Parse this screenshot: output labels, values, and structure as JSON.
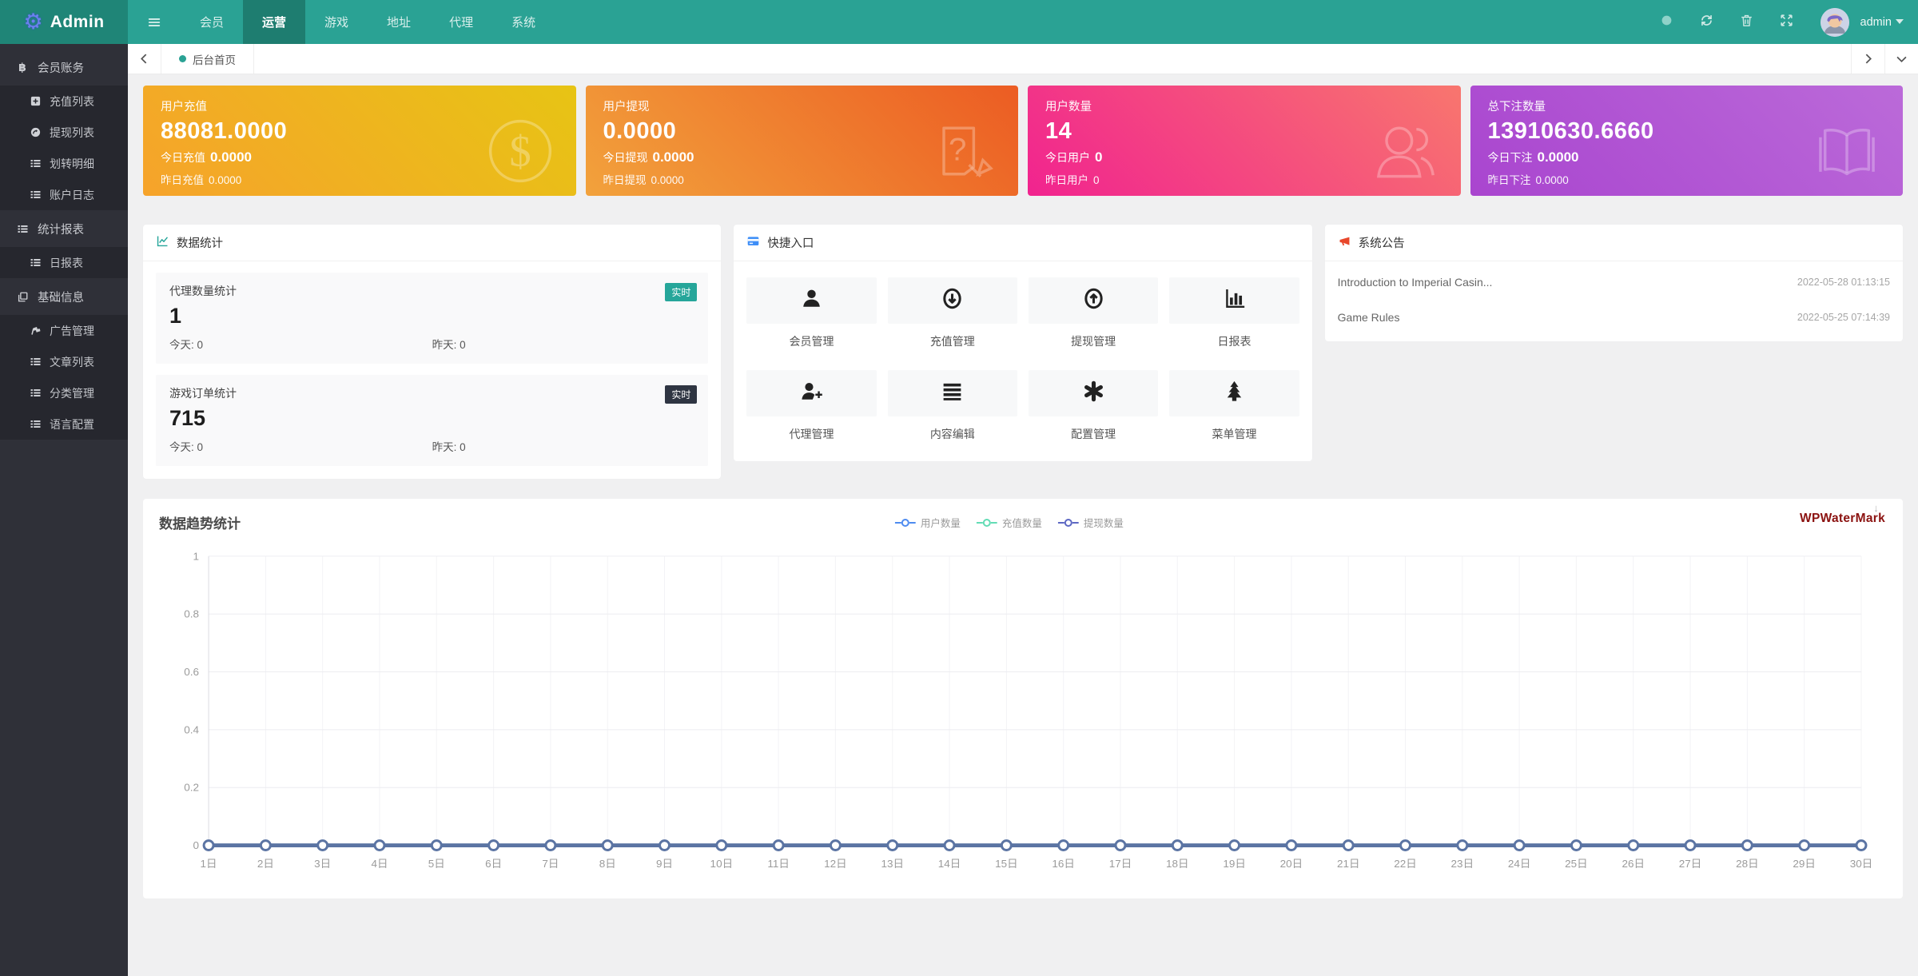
{
  "navbar": {
    "brand": "Admin",
    "brand_icon": "gear-icon",
    "hamburger": "hamburger-icon",
    "menu": [
      {
        "label": "会员",
        "active": false
      },
      {
        "label": "运营",
        "active": true
      },
      {
        "label": "游戏",
        "active": false
      },
      {
        "label": "地址",
        "active": false
      },
      {
        "label": "代理",
        "active": false
      },
      {
        "label": "系统",
        "active": false
      }
    ],
    "actions": [
      "globe-icon",
      "refresh-icon",
      "trash-icon",
      "fullscreen-icon"
    ],
    "user": {
      "name": "admin",
      "caret": "caret-down-icon",
      "avatar": "avatar"
    }
  },
  "sidebar": {
    "sections": [
      {
        "label": "会员账务",
        "icon": "bitcoin-icon",
        "children": [
          {
            "label": "充值列表",
            "icon": "plus-square-icon"
          },
          {
            "label": "提现列表",
            "icon": "redo-square-icon"
          },
          {
            "label": "划转明细",
            "icon": "list-icon"
          },
          {
            "label": "账户日志",
            "icon": "list-icon"
          }
        ]
      },
      {
        "label": "统计报表",
        "icon": "list-icon",
        "children": [
          {
            "label": "日报表",
            "icon": "list-icon"
          }
        ]
      },
      {
        "label": "基础信息",
        "icon": "copy-icon",
        "children": [
          {
            "label": "广告管理",
            "icon": "ad-icon"
          },
          {
            "label": "文章列表",
            "icon": "list-icon"
          },
          {
            "label": "分类管理",
            "icon": "list-icon"
          },
          {
            "label": "语言配置",
            "icon": "list-icon"
          }
        ]
      }
    ]
  },
  "tabbar": {
    "active_tab": "后台首页"
  },
  "stat_cards": [
    {
      "title": "用户充值",
      "value": "88081.0000",
      "today_label": "今日充值",
      "today_value": "0.0000",
      "yesterday_label": "昨日充值",
      "yesterday_value": "0.0000",
      "icon": "dollar-circle-icon",
      "gradient": [
        "#f6a32b",
        "#e7c414"
      ]
    },
    {
      "title": "用户提现",
      "value": "0.0000",
      "today_label": "今日提现",
      "today_value": "0.0000",
      "yesterday_label": "昨日提现",
      "yesterday_value": "0.0000",
      "icon": "doc-question-icon",
      "gradient": [
        "#f2a23c",
        "#ec5c23"
      ]
    },
    {
      "title": "用户数量",
      "value": "14",
      "today_label": "今日用户",
      "today_value": "0",
      "yesterday_label": "昨日用户",
      "yesterday_value": "0",
      "icon": "users-icon",
      "gradient": [
        "#f1238f",
        "#f8766e"
      ]
    },
    {
      "title": "总下注数量",
      "value": "13910630.6660",
      "today_label": "今日下注",
      "today_value": "0.0000",
      "yesterday_label": "昨日下注",
      "yesterday_value": "0.0000",
      "icon": "book-icon",
      "gradient": [
        "#a945cf",
        "#bb6ad9"
      ]
    }
  ],
  "panels": {
    "data_stats": {
      "title": "数据统计",
      "icon": "chart-line-icon",
      "icon_color": "#26a69a",
      "items": [
        {
          "title": "代理数量统计",
          "badge": "实时",
          "badge_color": "#26a69a",
          "value": "1",
          "today_label": "今天:",
          "today_value": "0",
          "yesterday_label": "昨天:",
          "yesterday_value": "0"
        },
        {
          "title": "游戏订单统计",
          "badge": "实时",
          "badge_color": "#2f3542",
          "value": "715",
          "today_label": "今天:",
          "today_value": "0",
          "yesterday_label": "昨天:",
          "yesterday_value": "0"
        }
      ]
    },
    "quick_entry": {
      "title": "快捷入口",
      "icon": "credit-card-icon",
      "icon_color": "#3e8ef7",
      "items": [
        {
          "label": "会员管理",
          "icon": "user-icon"
        },
        {
          "label": "充值管理",
          "icon": "download-circle-icon"
        },
        {
          "label": "提现管理",
          "icon": "upload-circle-icon"
        },
        {
          "label": "日报表",
          "icon": "bar-chart-icon"
        },
        {
          "label": "代理管理",
          "icon": "user-plus-icon"
        },
        {
          "label": "内容编辑",
          "icon": "lines-icon"
        },
        {
          "label": "配置管理",
          "icon": "asterisk-icon"
        },
        {
          "label": "菜单管理",
          "icon": "tree-icon"
        }
      ]
    },
    "announcements": {
      "title": "系统公告",
      "icon": "megaphone-icon",
      "icon_color": "#e8472b",
      "items": [
        {
          "title": "Introduction to Imperial Casin...",
          "date": "2022-05-28 01:13:15"
        },
        {
          "title": "Game Rules",
          "date": "2022-05-25 07:14:39"
        }
      ]
    }
  },
  "chart_data": {
    "type": "line",
    "title": "数据趋势统计",
    "watermark": "WPWaterMark",
    "categories": [
      "1日",
      "2日",
      "3日",
      "4日",
      "5日",
      "6日",
      "7日",
      "8日",
      "9日",
      "10日",
      "11日",
      "12日",
      "13日",
      "14日",
      "15日",
      "16日",
      "17日",
      "18日",
      "19日",
      "20日",
      "21日",
      "22日",
      "23日",
      "24日",
      "25日",
      "26日",
      "27日",
      "28日",
      "29日",
      "30日"
    ],
    "series": [
      {
        "name": "用户数量",
        "color": "#4e8bf0",
        "values": [
          0,
          0,
          0,
          0,
          0,
          0,
          0,
          0,
          0,
          0,
          0,
          0,
          0,
          0,
          0,
          0,
          0,
          0,
          0,
          0,
          0,
          0,
          0,
          0,
          0,
          0,
          0,
          0,
          0,
          0
        ]
      },
      {
        "name": "充值数量",
        "color": "#63dcb5",
        "values": [
          0,
          0,
          0,
          0,
          0,
          0,
          0,
          0,
          0,
          0,
          0,
          0,
          0,
          0,
          0,
          0,
          0,
          0,
          0,
          0,
          0,
          0,
          0,
          0,
          0,
          0,
          0,
          0,
          0,
          0
        ]
      },
      {
        "name": "提现数量",
        "color": "#5d68c3",
        "values": [
          0,
          0,
          0,
          0,
          0,
          0,
          0,
          0,
          0,
          0,
          0,
          0,
          0,
          0,
          0,
          0,
          0,
          0,
          0,
          0,
          0,
          0,
          0,
          0,
          0,
          0,
          0,
          0,
          0,
          0
        ]
      }
    ],
    "visible_line_color": "#5b74a3",
    "ylim": [
      0,
      1
    ],
    "yticks": [
      0,
      0.2,
      0.4,
      0.6,
      0.8,
      1
    ],
    "grid": true,
    "legend_position": "top-center"
  }
}
